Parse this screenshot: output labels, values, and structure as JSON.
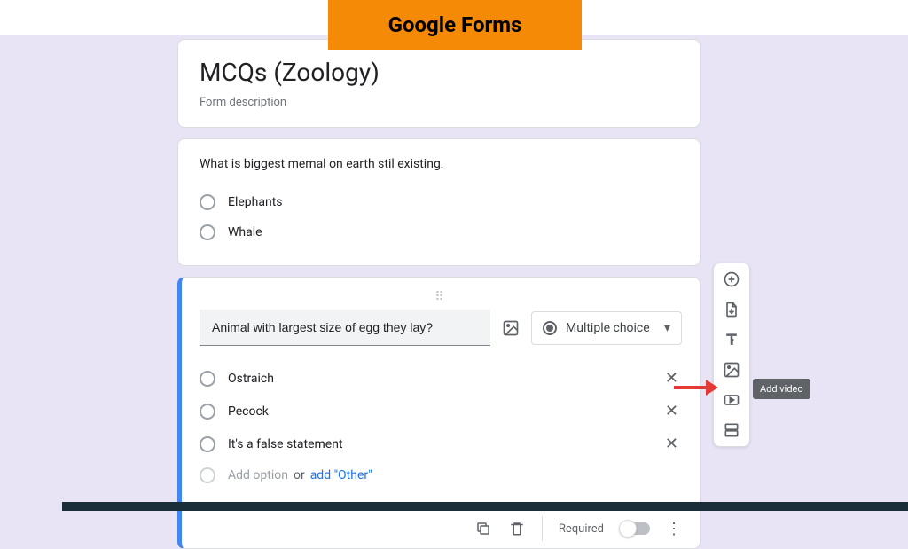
{
  "banner": {
    "text": "Google Forms"
  },
  "form": {
    "title": "MCQs (Zoology)",
    "description": "Form description"
  },
  "question1": {
    "text": "What is biggest memal on earth stil existing.",
    "options": [
      "Elephants",
      "Whale"
    ]
  },
  "question2": {
    "text": "Animal with largest size of egg they lay?",
    "type_label": "Multiple choice",
    "options": [
      "Ostraich",
      "Pecock",
      "It's a false statement"
    ],
    "add_option_label": "Add option",
    "or_label": "or",
    "add_other_label": "add \"Other\""
  },
  "footer": {
    "required_label": "Required"
  },
  "tooltip": {
    "text": "Add video"
  }
}
